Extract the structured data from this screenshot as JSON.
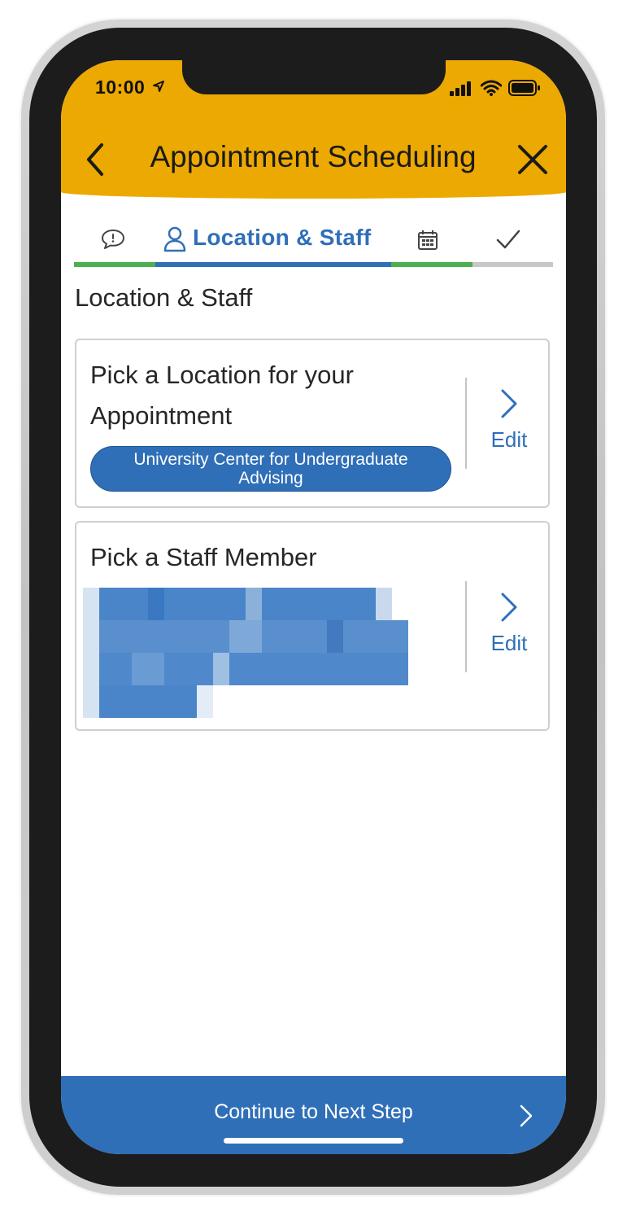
{
  "status_bar": {
    "time": "10:00"
  },
  "header": {
    "title": "Appointment Scheduling",
    "back_icon": "chevron-left-icon",
    "close_icon": "close-icon"
  },
  "tabs": [
    {
      "icon": "speech-bubble-icon",
      "label": "",
      "state": "complete"
    },
    {
      "icon": "person-icon",
      "label": "Location & Staff",
      "state": "active"
    },
    {
      "icon": "calendar-icon",
      "label": "",
      "state": "complete"
    },
    {
      "icon": "checkmark-icon",
      "label": "",
      "state": "pending"
    }
  ],
  "colors": {
    "header": "#eca901",
    "accent": "#2f6fb8",
    "progress_complete": "#4caf50",
    "progress_pending": "#c8c8c8"
  },
  "main": {
    "section_title": "Location & Staff",
    "location_card": {
      "title_line1": "Pick a Location for your",
      "title_line2": "Appointment",
      "selected_line1": "University Center for Undergraduate",
      "selected_line2": "Advising",
      "edit_label": "Edit"
    },
    "staff_card": {
      "title": "Pick a Staff Member",
      "edit_label": "Edit"
    }
  },
  "footer": {
    "continue_label": "Continue to Next Step"
  }
}
